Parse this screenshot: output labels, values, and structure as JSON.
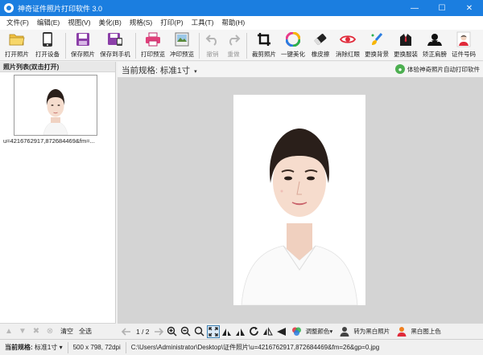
{
  "window": {
    "title": "神奇证件照片打印软件 3.0",
    "minimize": "—",
    "maximize": "☐",
    "close": "✕"
  },
  "menu": [
    "文件(F)",
    "编辑(E)",
    "视图(V)",
    "美化(B)",
    "规格(S)",
    "打印(P)",
    "工具(T)",
    "帮助(H)"
  ],
  "toolbar": {
    "open_photo": "打开照片",
    "open_device": "打开设备",
    "save_photo": "保存照片",
    "save_to_phone": "保存到手机",
    "print_preview": "打印预览",
    "wash_preview": "冲印预览",
    "undo": "撤销",
    "redo": "重做",
    "crop_photo": "裁剪照片",
    "beautify": "一键美化",
    "eraser": "橡皮擦",
    "red_eye": "消除红眼",
    "change_bg": "更换背景",
    "change_suit": "更换服装",
    "correct_shoulder": "矫正肩膀",
    "id_code": "证件号码"
  },
  "left_panel": {
    "header": "照片列表(双击打开)",
    "filename": "u=4216762917,872684469&fm=...",
    "clear": "清空",
    "select_all": "全选"
  },
  "main": {
    "spec_label": "当前规格:",
    "spec_value": "标准1寸",
    "auto_print": "体验神奇照片自动打印软件",
    "page": "1 / 2",
    "adjust_color": "调整颜色",
    "to_bw": "转为黑白照片",
    "bw_color": "黑白图上色"
  },
  "status": {
    "spec_label": "当前规格:",
    "spec_value": "标准1寸",
    "info": "500 x 798, 72dpi",
    "path": "C:\\Users\\Administrator\\Desktop\\证件照片\\u=4216762917,872684469&fm=26&gp=0.jpg"
  },
  "colors": {
    "titlebar": "#1b7ee0",
    "canvas": "#d4d4d4",
    "accent_red": "#e02a3a",
    "accent_purple": "#8b3fa8"
  }
}
